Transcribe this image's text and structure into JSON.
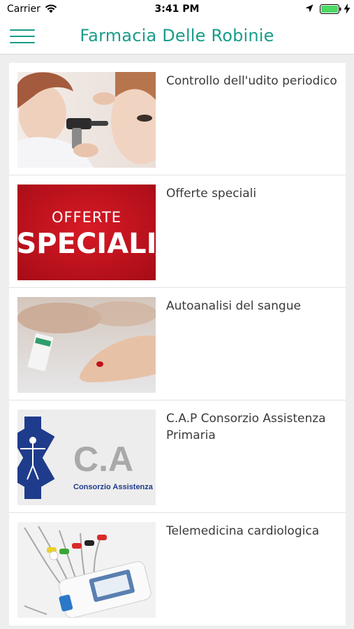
{
  "status_bar": {
    "carrier": "Carrier",
    "time": "3:41 PM"
  },
  "header": {
    "title": "Farmacia Delle Robinie",
    "menu_icon": "hamburger-menu-icon"
  },
  "items": [
    {
      "title": "Controllo dell'udito periodico",
      "image": "ear-examination-photo"
    },
    {
      "title": "Offerte speciali",
      "image": "special-offers-banner",
      "image_text_top": "OFFERTE",
      "image_text_main": "SPECIALI"
    },
    {
      "title": "Autoanalisi del sangue",
      "image": "blood-test-photo"
    },
    {
      "title": "C.A.P Consorzio Assistenza Primaria",
      "image": "cap-logo",
      "image_text_main": "C.A",
      "image_text_sub": "Consorzio Assistenza"
    },
    {
      "title": "Telemedicina cardiologica",
      "image": "ecg-device-photo"
    }
  ],
  "colors": {
    "accent": "#1a9c8a",
    "offer_red": "#c8101d",
    "logo_blue": "#1f3c8c"
  }
}
